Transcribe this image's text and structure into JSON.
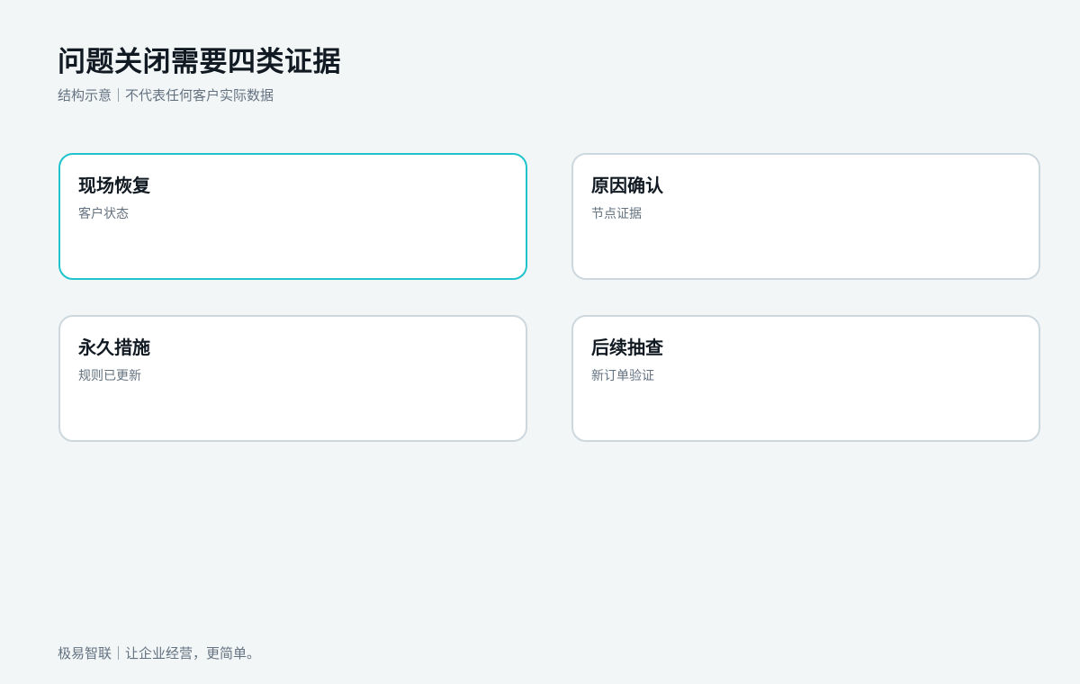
{
  "title": "问题关闭需要四类证据",
  "subtitle": "结构示意｜不代表任何客户实际数据",
  "cards": [
    {
      "title": "现场恢复",
      "desc": "客户状态",
      "highlighted": true
    },
    {
      "title": "原因确认",
      "desc": "节点证据",
      "highlighted": false
    },
    {
      "title": "永久措施",
      "desc": "规则已更新",
      "highlighted": false
    },
    {
      "title": "后续抽查",
      "desc": "新订单验证",
      "highlighted": false
    }
  ],
  "colors": {
    "highlight_border": "#1fc3cc",
    "default_border": "#cdd8de",
    "background": "#f2f6f7"
  },
  "footer": "极易智联｜让企业经营，更简单。"
}
